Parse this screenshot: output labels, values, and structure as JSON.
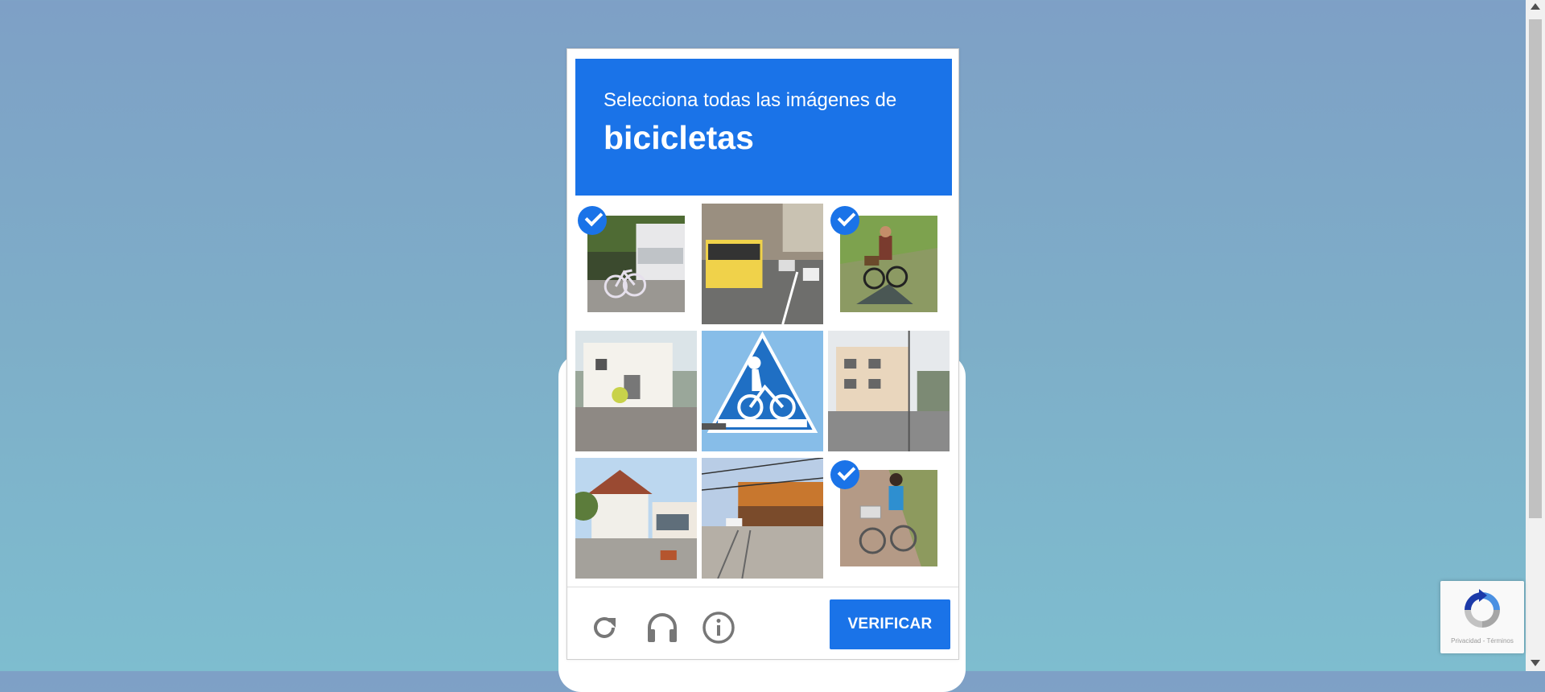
{
  "challenge": {
    "instruction": "Selecciona todas las imágenes de",
    "target": "bicicletas",
    "tiles": [
      {
        "description": "bike-near-van",
        "selected": true
      },
      {
        "description": "street-with-bus",
        "selected": false
      },
      {
        "description": "person-riding-bike",
        "selected": true
      },
      {
        "description": "white-house-street",
        "selected": false
      },
      {
        "description": "bicycle-crossing-sign",
        "selected": false
      },
      {
        "description": "apartment-street",
        "selected": false
      },
      {
        "description": "house-corner-street",
        "selected": false
      },
      {
        "description": "street-with-shops",
        "selected": false
      },
      {
        "description": "child-on-bike",
        "selected": true
      }
    ],
    "verify_label": "VERIFICAR",
    "controls": [
      "reload-icon",
      "headphones-icon",
      "info-icon"
    ]
  },
  "badge": {
    "privacy": "Privacidad",
    "separator": "-",
    "terms": "Términos"
  },
  "colors": {
    "accent": "#1a73e8",
    "background_top": "#7ea0c6",
    "background_bottom": "#7ebdcf"
  }
}
